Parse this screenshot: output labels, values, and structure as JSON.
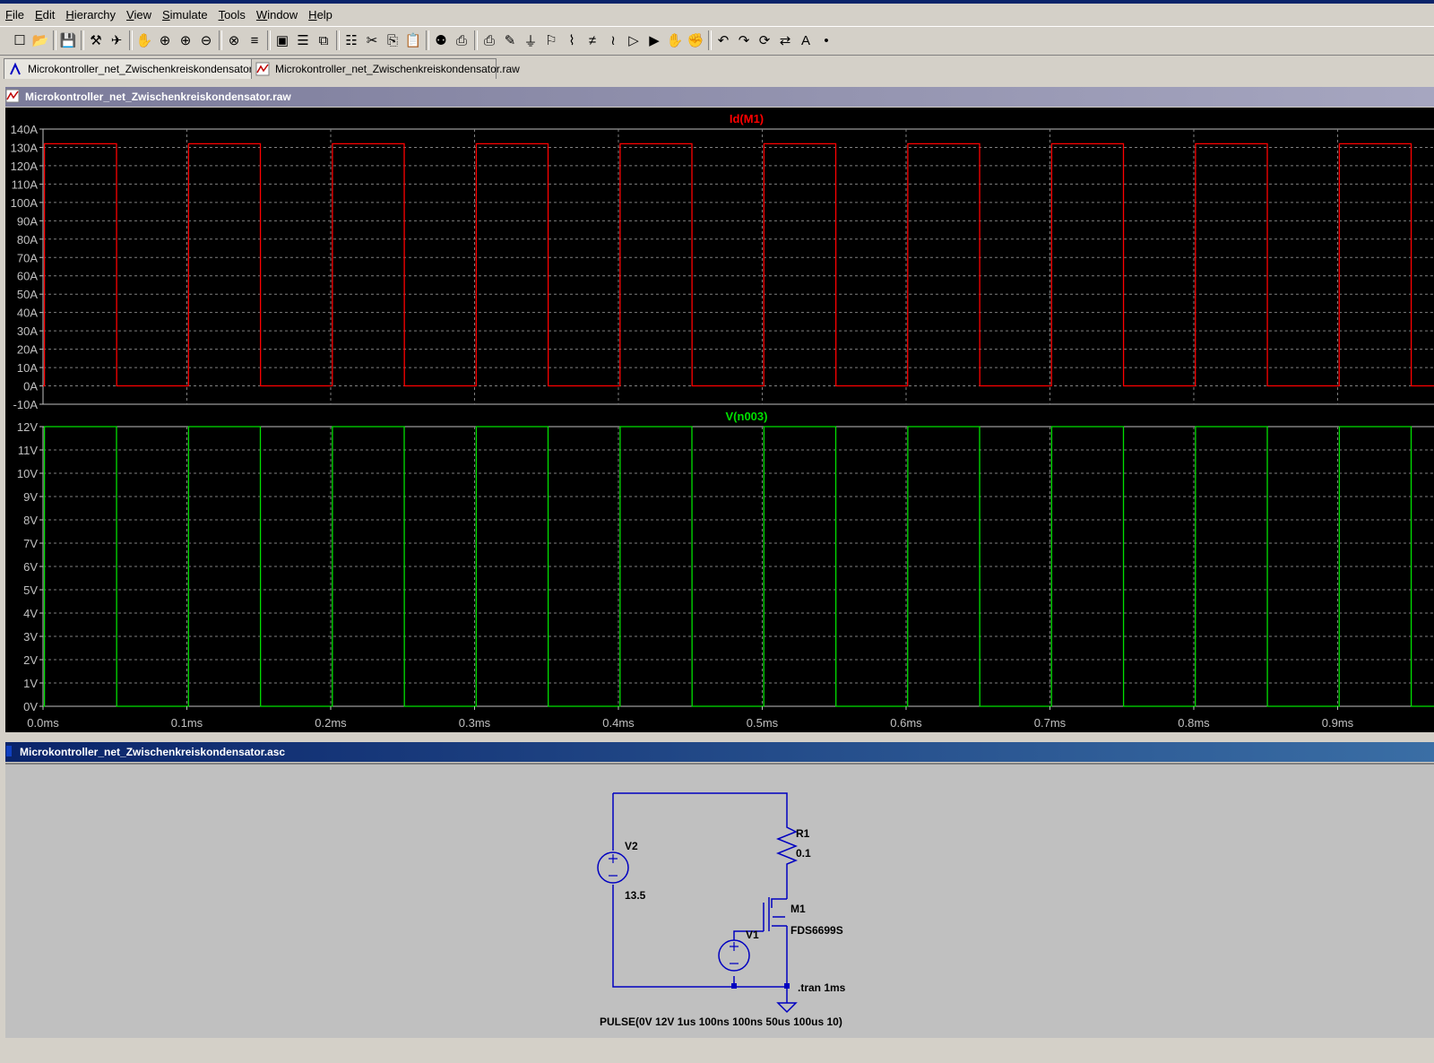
{
  "menu": [
    "File",
    "Edit",
    "Hierarchy",
    "View",
    "Simulate",
    "Tools",
    "Window",
    "Help"
  ],
  "toolbar_icons": [
    "new-schematic",
    "open",
    "save",
    "control-panel",
    "run",
    "halt",
    "zoom-in",
    "zoom-pan",
    "zoom-out",
    "zoom-cancel",
    "autorange",
    "fit",
    "tile-horizontal",
    "cascade",
    "tile-vertical",
    "cut",
    "copy",
    "paste",
    "find",
    "print-preview",
    "print",
    "draw-wire",
    "ground",
    "label-net",
    "resistor",
    "capacitor",
    "inductor",
    "diode",
    "component",
    "move",
    "drag",
    "undo",
    "redo",
    "rotate",
    "mirror",
    "text",
    "spice-directive"
  ],
  "tabs": [
    {
      "label": "Microkontroller_net_Zwischenkreiskondensator.asc",
      "icon": "schematic-icon"
    },
    {
      "label": "Microkontroller_net_Zwischenkreiskondensator.raw",
      "icon": "waveform-icon"
    }
  ],
  "wave_window": {
    "title": "Microkontroller_net_Zwischenkreiskondensator.raw"
  },
  "sch_window": {
    "title": "Microkontroller_net_Zwischenkreiskondensator.asc"
  },
  "colors": {
    "trace_current": "#ff0000",
    "trace_voltage": "#00e000",
    "axis": "#c0c0c0",
    "plot_bg": "#000000",
    "schem_wire": "#0000c0"
  },
  "chart_data": [
    {
      "type": "line",
      "title": "Id(M1)",
      "xlim": [
        0,
        1.0
      ],
      "ylim": [
        -10,
        140
      ],
      "yticks": [
        "140A",
        "130A",
        "120A",
        "110A",
        "100A",
        "90A",
        "80A",
        "70A",
        "60A",
        "50A",
        "40A",
        "30A",
        "20A",
        "10A",
        "0A",
        "-10A"
      ],
      "series": [
        {
          "name": "Id(M1)",
          "color": "#ff0000",
          "x": [
            0,
            0.001,
            0.001,
            0.0511,
            0.0512,
            0.1011,
            0.1012,
            0.1511,
            0.1512,
            0.2011,
            0.2012,
            0.2511,
            0.2512,
            0.3011,
            0.3012,
            0.3511,
            0.3512,
            0.4011,
            0.4012,
            0.4511,
            0.4512,
            0.5011,
            0.5012,
            0.5511,
            0.5512,
            0.6011,
            0.6012,
            0.6511,
            0.6512,
            0.7011,
            0.7012,
            0.7511,
            0.7512,
            0.8011,
            0.8012,
            0.8511,
            0.8512,
            0.9011,
            0.9012,
            0.9511,
            0.9512,
            1.0
          ],
          "y": [
            0,
            0,
            132,
            132,
            0,
            0,
            132,
            132,
            0,
            0,
            132,
            132,
            0,
            0,
            132,
            132,
            0,
            0,
            132,
            132,
            0,
            0,
            132,
            132,
            0,
            0,
            132,
            132,
            0,
            0,
            132,
            132,
            0,
            0,
            132,
            132,
            0,
            0,
            132,
            132,
            0,
            0
          ]
        }
      ]
    },
    {
      "type": "line",
      "title": "V(n003)",
      "xlabel_unit": "ms",
      "xlim": [
        0,
        1.0
      ],
      "ylim": [
        0,
        12
      ],
      "yticks": [
        "12V",
        "11V",
        "10V",
        "9V",
        "8V",
        "7V",
        "6V",
        "5V",
        "4V",
        "3V",
        "2V",
        "1V",
        "0V"
      ],
      "xticks": [
        "0.0ms",
        "0.1ms",
        "0.2ms",
        "0.3ms",
        "0.4ms",
        "0.5ms",
        "0.6ms",
        "0.7ms",
        "0.8ms",
        "0.9ms"
      ],
      "series": [
        {
          "name": "V(n003)",
          "color": "#00e000",
          "x": [
            0,
            0.001,
            0.001,
            0.0511,
            0.0512,
            0.1011,
            0.1012,
            0.1511,
            0.1512,
            0.2011,
            0.2012,
            0.2511,
            0.2512,
            0.3011,
            0.3012,
            0.3511,
            0.3512,
            0.4011,
            0.4012,
            0.4511,
            0.4512,
            0.5011,
            0.5012,
            0.5511,
            0.5512,
            0.6011,
            0.6012,
            0.6511,
            0.6512,
            0.7011,
            0.7012,
            0.7511,
            0.7512,
            0.8011,
            0.8012,
            0.8511,
            0.8512,
            0.9011,
            0.9012,
            0.9511,
            0.9512,
            1.0
          ],
          "y": [
            0,
            0,
            12,
            12,
            0,
            0,
            12,
            12,
            0,
            0,
            12,
            12,
            0,
            0,
            12,
            12,
            0,
            0,
            12,
            12,
            0,
            0,
            12,
            12,
            0,
            0,
            12,
            12,
            0,
            0,
            12,
            12,
            0,
            0,
            12,
            12,
            0,
            0,
            12,
            12,
            0,
            0
          ]
        }
      ]
    }
  ],
  "schematic": {
    "v2_name": "V2",
    "v2_value": "13.5",
    "r1_name": "R1",
    "r1_value": "0.1",
    "m1_name": "M1",
    "m1_model": "FDS6699S",
    "v1_name": "V1",
    "directive": ".tran 1ms",
    "pulse": "PULSE(0V 12V 1us 100ns 100ns 50us 100us 10)"
  }
}
